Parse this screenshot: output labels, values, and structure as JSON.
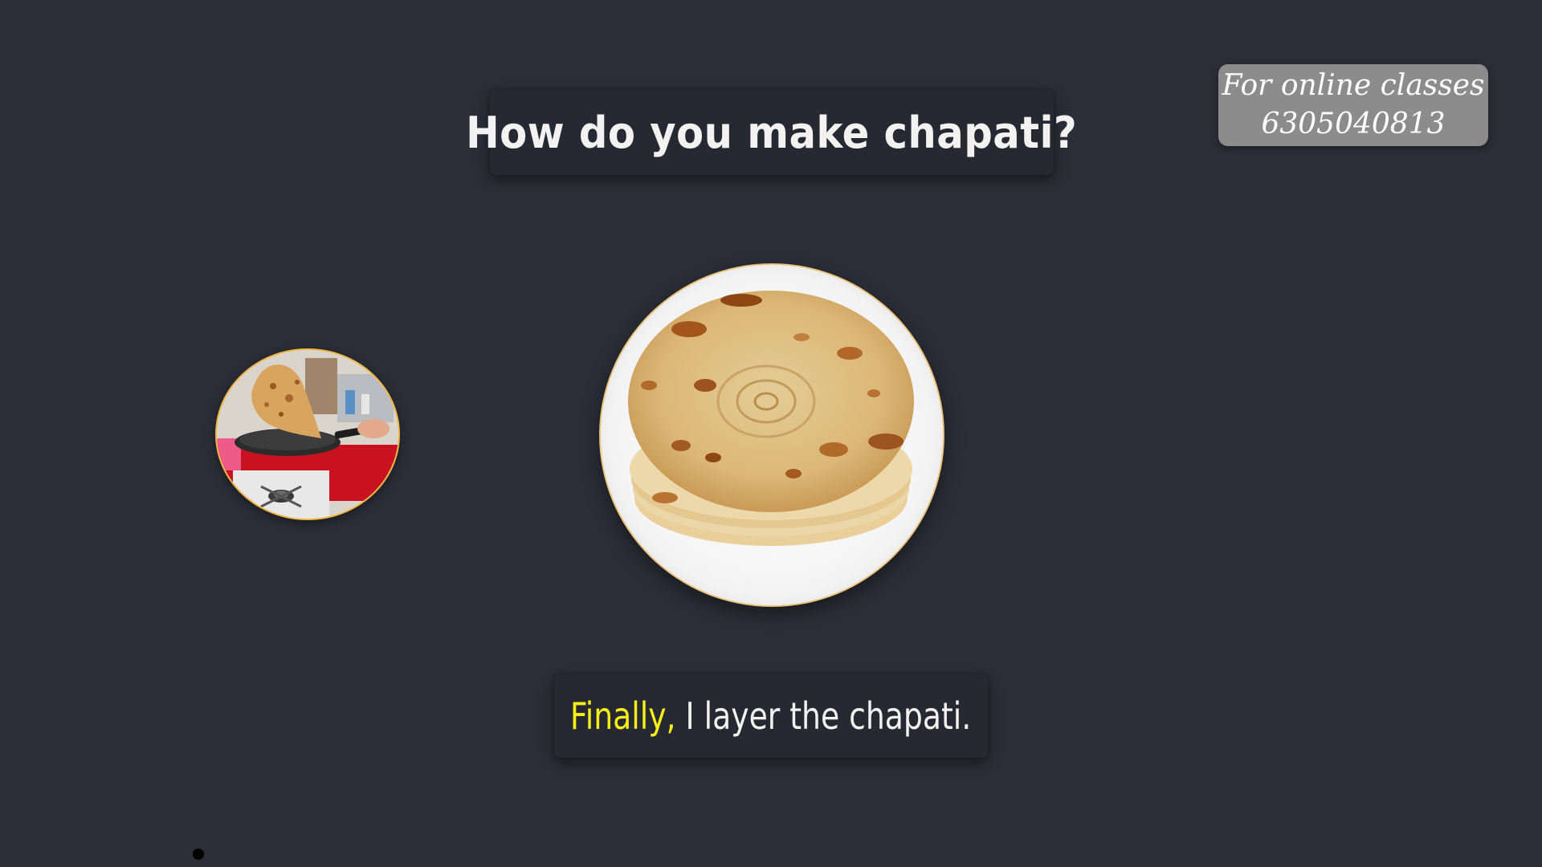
{
  "title": {
    "text": "How do you make chapati?"
  },
  "promo": {
    "line1": "For online classes",
    "line2": "6305040813"
  },
  "images": {
    "small_circle_icon": "pan-flipping-chapati-photo",
    "plate_icon": "plate-of-chapati-photo"
  },
  "caption": {
    "highlight": "Finally,",
    "rest": " I layer the chapati."
  },
  "colors": {
    "background": "#2b2e38",
    "card": "#262931",
    "highlight": "#f5ee1a",
    "promo_box": "#8c8c8c",
    "circle_border": "#f2b640"
  }
}
